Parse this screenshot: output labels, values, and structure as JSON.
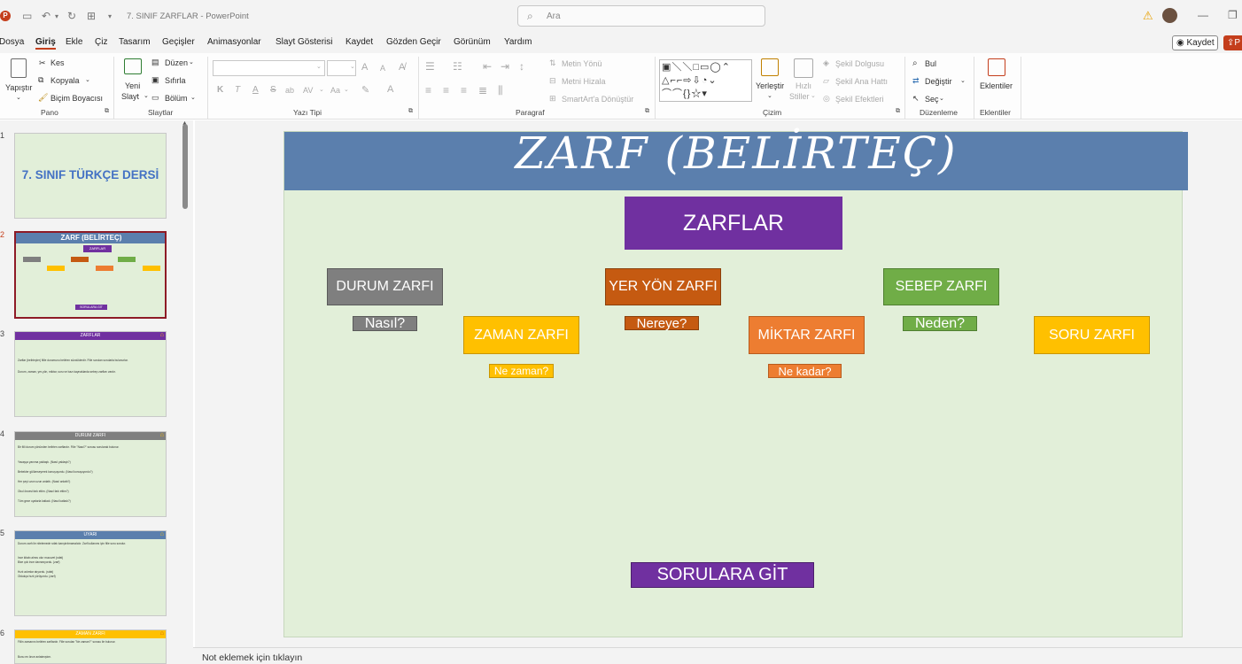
{
  "window": {
    "title": "7. SINIF ZARFLAR  -  PowerPoint",
    "search_placeholder": "Ara",
    "app_logo": "P"
  },
  "menu": {
    "items": [
      "Dosya",
      "Giriş",
      "Ekle",
      "Çiz",
      "Tasarım",
      "Geçişler",
      "Animasyonlar",
      "Slayt Gösterisi",
      "Kaydet",
      "Gözden Geçir",
      "Görünüm",
      "Yardım"
    ],
    "active": "Giriş",
    "record_button": "Kaydet",
    "share_button": "P"
  },
  "ribbon": {
    "pano": {
      "paste": "Yapıştır",
      "cut": "Kes",
      "copy": "Kopyala",
      "format_painter": "Biçim Boyacısı",
      "label": "Pano"
    },
    "slaytlar": {
      "new_slide_1": "Yeni",
      "new_slide_2": "Slayt",
      "layout": "Düzen",
      "reset": "Sıfırla",
      "section": "Bölüm",
      "label": "Slaytlar"
    },
    "yazi_tipi": {
      "bold": "K",
      "italic": "T",
      "underline": "A",
      "strike": "S",
      "shadow": "ab",
      "spacing": "AV",
      "case": "Aa",
      "grow": "A",
      "shrink": "A",
      "label": "Yazı Tipi"
    },
    "paragraf": {
      "text_direction": "Metin Yönü",
      "align_text": "Metni Hizala",
      "smartart": "SmartArt'a Dönüştür",
      "label": "Paragraf"
    },
    "cizim": {
      "arrange": "Yerleştir",
      "quick_styles_1": "Hızlı",
      "quick_styles_2": "Stiller",
      "shape_fill": "Şekil Dolgusu",
      "shape_outline": "Şekil Ana Hattı",
      "shape_effects": "Şekil Efektleri",
      "label": "Çizim"
    },
    "duzenleme": {
      "find": "Bul",
      "replace": "Değiştir",
      "select": "Seç",
      "label": "Düzenleme"
    },
    "eklentiler": {
      "addins": "Eklentiler",
      "label": "Eklentiler"
    }
  },
  "thumbnails": [
    {
      "num": "1",
      "title": "7. SINIF TÜRKÇE DERSİ"
    },
    {
      "num": "2",
      "title": "ZARF (BELİRTEÇ)",
      "sub": "ZARFLAR",
      "link": "SORULARA GİT"
    },
    {
      "num": "3",
      "title": "ZARFLAR",
      "line1": "Zarflar (belirteçler) fiille durumunu belirten sözcüklerdir. Fiile sorulan sorularla bulunurlar.",
      "line2": "Durum, zaman, yer-yön, miktar, soru ve bazı kaynaklarda sebep zarfları vardır."
    },
    {
      "num": "4",
      "title": "DURUM ZARFI",
      "line1": "Bir fiili durum yönünden belirten zarflardır. Fiile \"Nasıl?\" sorusu sorularak bulunur.",
      "line2": "Yavaşça yanıma yaklaştı. (Nasıl yaklaştı?)",
      "line3": "Bebekler gülümseyerek konuşuyordu. (Nasıl konuşuyordu?)",
      "line4": "Her şeyi uzun uzun anlattı. (Nasıl anlattı?)",
      "line5": "Okul öncesi fark ettim. (Nasıl fark ettim?)",
      "line6": "Tüm geze oyalarla katladı. (Nasıl katladı?)"
    },
    {
      "num": "5",
      "title": "UYARI",
      "line1": "Durum zarfı ile nitelemede sıfatı karıştırılmamalıdır. Zarf kullanımı için fiile soru sorulur.",
      "line2": "İnce kitabı almıs olur mucuvet (sıfat)",
      "line3": "Bize çok ince davranıyordu. (zarf)",
      "line4": "Hızlı adımlar atıyordu. (sıfat)",
      "line5": "Oldukça hızlı yürüyordu. (zarf)"
    },
    {
      "num": "6",
      "title": "ZAMAN ZARFI",
      "line1": "Fiilin zamanını belirten zarflardır. Fiile sorulan \"Ne zaman?\" sorusu ile bulunur.",
      "line2": "Bunu en önce anlatmıştım."
    }
  ],
  "slide": {
    "title": "ZARF (BELİRTEÇ)",
    "main_box": "ZARFLAR",
    "boxes": [
      {
        "label": "DURUM ZARFI",
        "question": "Nasıl?"
      },
      {
        "label": "ZAMAN ZARFI",
        "question": "Ne zaman?"
      },
      {
        "label": "YER YÖN ZARFI",
        "question": "Nereye?"
      },
      {
        "label": "MİKTAR ZARFI",
        "question": "Ne kadar?"
      },
      {
        "label": "SEBEP ZARFI",
        "question": "Neden?"
      },
      {
        "label": "SORU ZARFI"
      }
    ],
    "link_box": "SORULARA GİT"
  },
  "notes": {
    "placeholder": "Not eklemek için tıklayın"
  },
  "colors": {
    "ppt_red": "#c43e1c",
    "slide_bg": "#e2efd9",
    "banner": "#5b7fad",
    "purple": "#7030a0",
    "gray": "#7f7f7f",
    "orange_dark": "#c55a11",
    "orange": "#ed7d31",
    "green": "#70ad47",
    "yellow": "#ffc000"
  }
}
